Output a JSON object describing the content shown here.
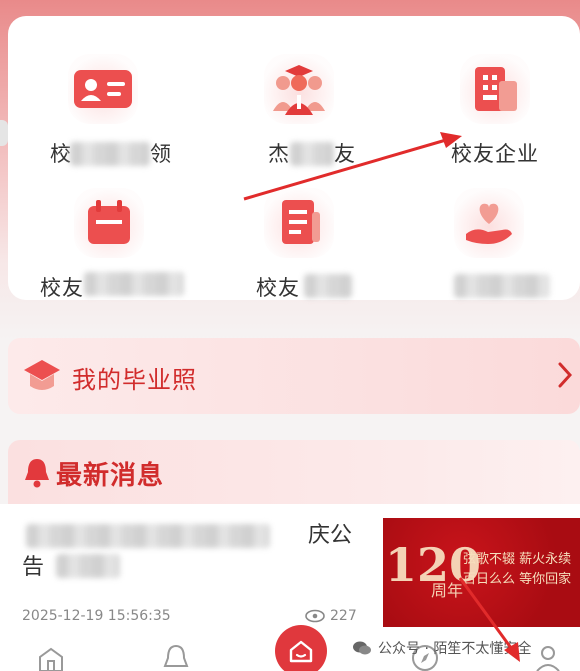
{
  "grid": {
    "items": [
      {
        "label": "校",
        "label_tail": "领",
        "icon": "id-card-icon"
      },
      {
        "label": "杰",
        "label_tail": "友",
        "icon": "graduates-icon"
      },
      {
        "label": "校友企业",
        "label_tail": "",
        "icon": "building-icon"
      },
      {
        "label": "校友",
        "label_tail": "",
        "icon": "calendar-icon"
      },
      {
        "label": "校友",
        "label_tail": "",
        "icon": "document-icon"
      },
      {
        "label": "",
        "label_tail": "",
        "icon": "heart-hand-icon"
      }
    ]
  },
  "graduation": {
    "label": "我的毕业照"
  },
  "news": {
    "header": "最新消息",
    "item": {
      "title_line1": "庆公",
      "title_line2": "告",
      "date": "2025-12-19 15:56:35",
      "views": "227",
      "image_number": "120",
      "image_suffix": "周年",
      "image_text1": "弦歌不辍 薪火永续",
      "image_text2": "百日么么 等你回家"
    }
  },
  "watermark": {
    "text": "公众号 · 陌笙不太懂安全"
  },
  "colors": {
    "accent": "#d12c2c",
    "home": "#e0383d",
    "arrow": "#e12b2b"
  }
}
